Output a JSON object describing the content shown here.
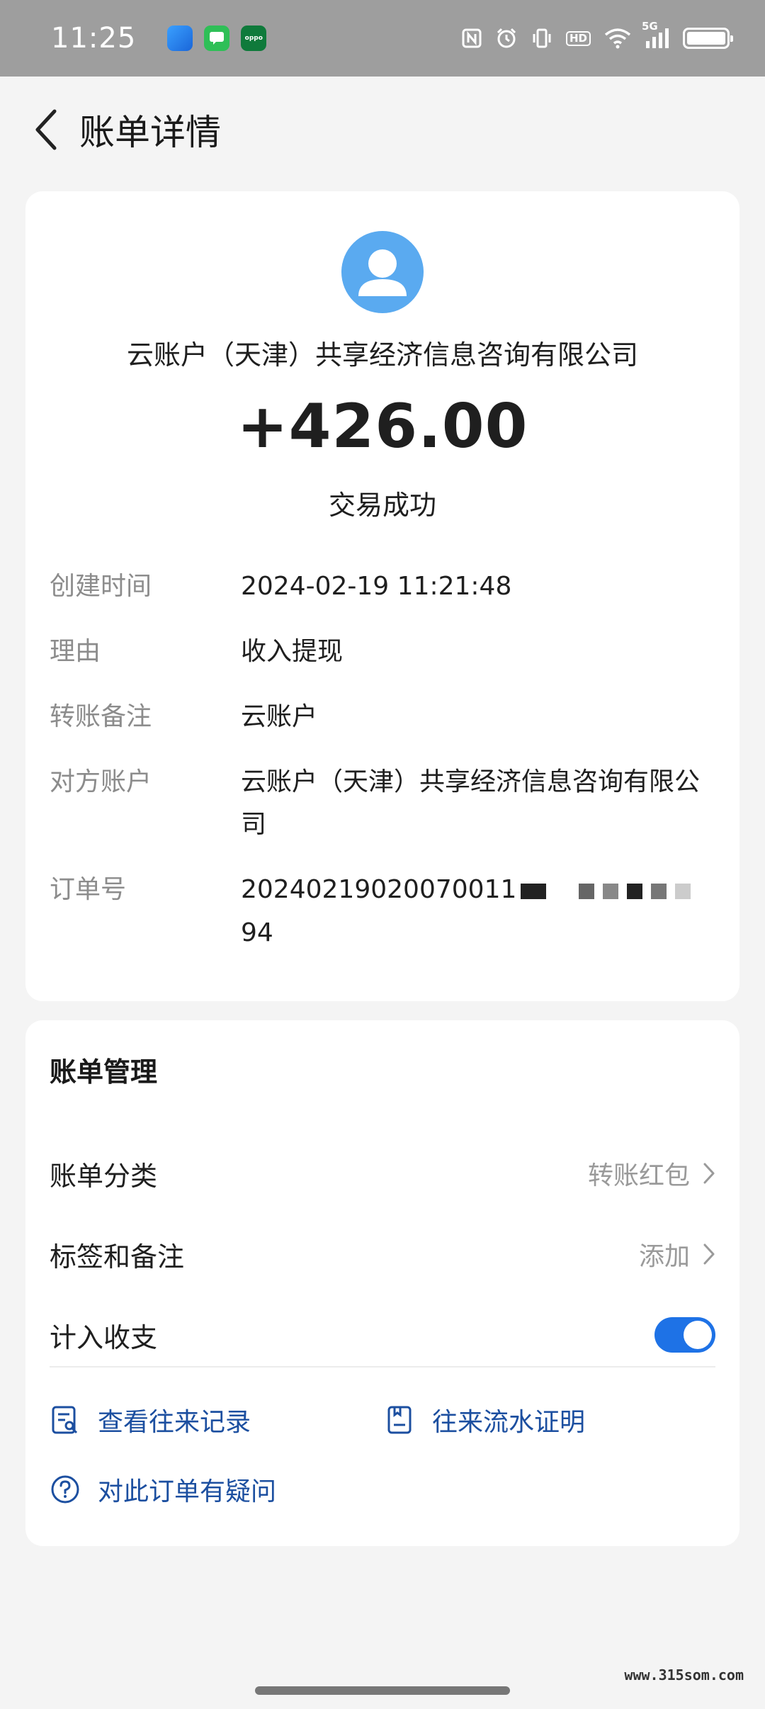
{
  "status_bar": {
    "time": "11:25",
    "network": "5G",
    "icons": [
      "nfc-icon",
      "alarm-icon",
      "vibrate-icon",
      "hd-icon",
      "wifi-icon",
      "signal-icon",
      "battery-icon"
    ],
    "apps": [
      "blue-app-icon",
      "green-chat-app-icon",
      "oppo-app-icon"
    ]
  },
  "header": {
    "title": "账单详情"
  },
  "transaction": {
    "payee": "云账户（天津）共享经济信息咨询有限公司",
    "amount": "+426.00",
    "status": "交易成功",
    "details": [
      {
        "label": "创建时间",
        "value": "2024-02-19 11:21:48"
      },
      {
        "label": "理由",
        "value": "收入提现"
      },
      {
        "label": "转账备注",
        "value": "云账户"
      },
      {
        "label": "对方账户",
        "value": "云账户（天津）共享经济信息咨询有限公司"
      },
      {
        "label": "订单号",
        "value_visible_start": "20240219020070011",
        "value_visible_end": "94"
      }
    ]
  },
  "manage": {
    "title": "账单管理",
    "category_label": "账单分类",
    "category_value": "转账红包",
    "tags_label": "标签和备注",
    "tags_value": "添加",
    "include_label": "计入收支",
    "include_on": true,
    "links": {
      "history": "查看往来记录",
      "proof": "往来流水证明",
      "question": "对此订单有疑问"
    }
  },
  "watermark": "www.315som.com",
  "colors": {
    "accent": "#1e72e6",
    "link": "#1c4fa0",
    "avatar": "#5aaaf0",
    "status_bar": "#9e9e9e"
  }
}
